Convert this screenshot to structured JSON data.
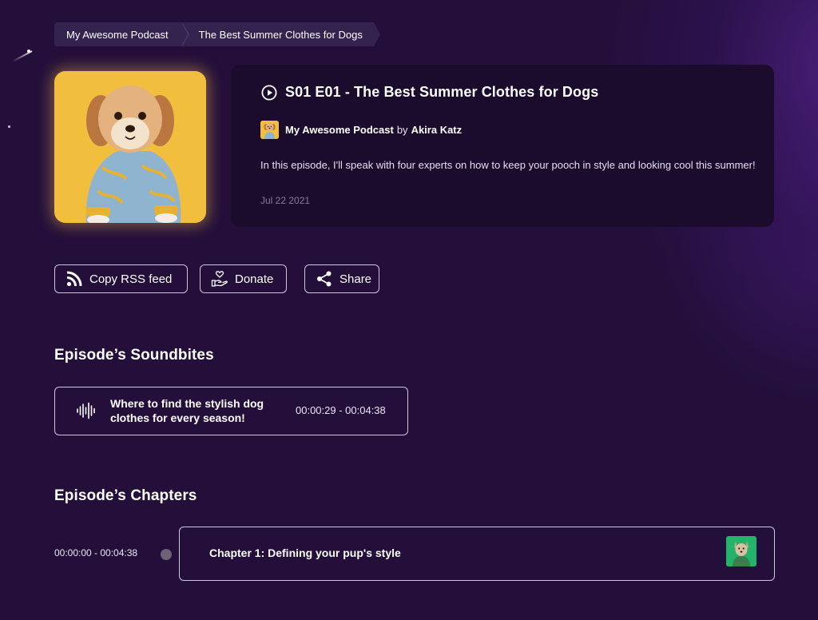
{
  "breadcrumb": {
    "items": [
      {
        "label": "My Awesome Podcast"
      },
      {
        "label": "The Best Summer Clothes for Dogs"
      }
    ]
  },
  "episode": {
    "title": "S01 E01 - The Best Summer Clothes for Dogs",
    "podcast_name": "My Awesome Podcast",
    "by_text": "by",
    "author": "Akira Katz",
    "description": "In this episode, I'll speak with four experts on how to keep your pooch in style and looking cool this summer!",
    "date": "Jul 22 2021",
    "cover_image": "dog-in-blue-pajamas-photo"
  },
  "actions": {
    "copy_rss_label": "Copy RSS feed",
    "donate_label": "Donate",
    "share_label": "Share"
  },
  "soundbites": {
    "heading": "Episode’s Soundbites",
    "items": [
      {
        "title": "Where to find the stylish dog clothes for every season!",
        "time_range": "00:00:29 - 00:04:38"
      }
    ]
  },
  "chapters": {
    "heading": "Episode’s Chapters",
    "items": [
      {
        "time_range": "00:00:00 - 00:04:38",
        "title": "Chapter 1: Defining your pup's style",
        "thumbnail": "dog-on-green-background-photo"
      }
    ]
  },
  "icons": {
    "play": "play-circle-icon",
    "rss": "rss-icon",
    "donate": "hand-heart-icon",
    "share": "share-icon",
    "soundbite": "audio-wave-icon"
  },
  "colors": {
    "background": "#230f3a",
    "card": "#1b0c2d",
    "breadcrumb": "#34224f",
    "cover_bg": "#f1be3e",
    "chapter_thumb_bg": "#24b36b",
    "muted_text": "#857b98"
  }
}
